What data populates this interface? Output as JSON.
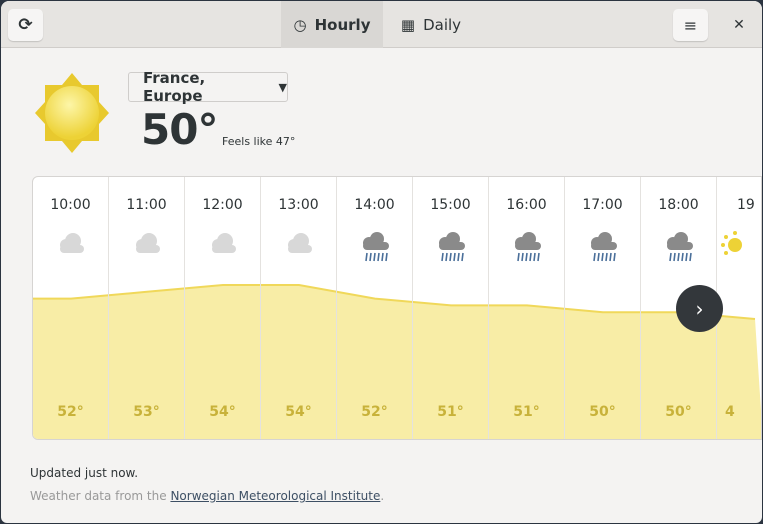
{
  "header": {
    "refresh_icon": "refresh-icon",
    "tabs": [
      {
        "label": "Hourly",
        "icon": "clock-icon",
        "active": true
      },
      {
        "label": "Daily",
        "icon": "calendar-icon",
        "active": false
      }
    ],
    "menu_icon": "hamburger-icon",
    "close_icon": "close-icon"
  },
  "current": {
    "icon": "sun-icon",
    "location": "France, Europe",
    "temperature": "50°",
    "feels_like": "Feels like 47°"
  },
  "hourly": [
    {
      "time": "10:00",
      "icon": "cloudy-icon",
      "temp": "52°",
      "value": 52
    },
    {
      "time": "11:00",
      "icon": "cloudy-icon",
      "temp": "53°",
      "value": 53
    },
    {
      "time": "12:00",
      "icon": "cloudy-icon",
      "temp": "54°",
      "value": 54
    },
    {
      "time": "13:00",
      "icon": "cloudy-icon",
      "temp": "54°",
      "value": 54
    },
    {
      "time": "14:00",
      "icon": "rain-icon",
      "temp": "52°",
      "value": 52
    },
    {
      "time": "15:00",
      "icon": "rain-icon",
      "temp": "51°",
      "value": 51
    },
    {
      "time": "16:00",
      "icon": "rain-icon",
      "temp": "51°",
      "value": 51
    },
    {
      "time": "17:00",
      "icon": "rain-icon",
      "temp": "50°",
      "value": 50
    },
    {
      "time": "18:00",
      "icon": "rain-icon",
      "temp": "50°",
      "value": 50
    },
    {
      "time": "19",
      "icon": "partly-sunny-icon",
      "temp": "4",
      "value": 49
    }
  ],
  "colors": {
    "graph_fill": "#f8eda6",
    "graph_line": "#f0d85a"
  },
  "footer": {
    "updated": "Updated just now.",
    "source_prefix": "Weather data from the ",
    "source_link": "Norwegian Meteorological Institute",
    "source_suffix": "."
  }
}
